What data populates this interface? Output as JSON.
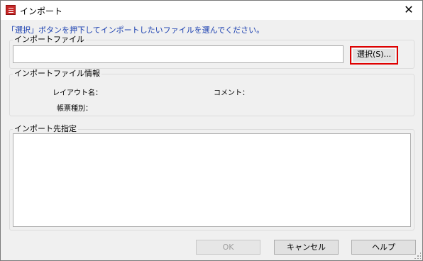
{
  "window": {
    "title": "インポート",
    "close_glyph": "✕",
    "icon": "table-icon",
    "accent_color": "#c62828"
  },
  "instruction": "「選択」ボタンを押下してインポートしたいファイルを選んでください。",
  "import_file": {
    "legend": "インポートファイル",
    "path_value": "",
    "select_button": "選択(S)..."
  },
  "file_info": {
    "legend": "インポートファイル情報",
    "layout_name_label": "レイアウト名：",
    "layout_name_value": "",
    "comment_label": "コメント：",
    "comment_value": "",
    "form_type_label": "帳票種別：",
    "form_type_value": ""
  },
  "target": {
    "legend": "インポート先指定"
  },
  "buttons": {
    "ok": "OK",
    "cancel": "キャンセル",
    "help": "ヘルプ"
  }
}
